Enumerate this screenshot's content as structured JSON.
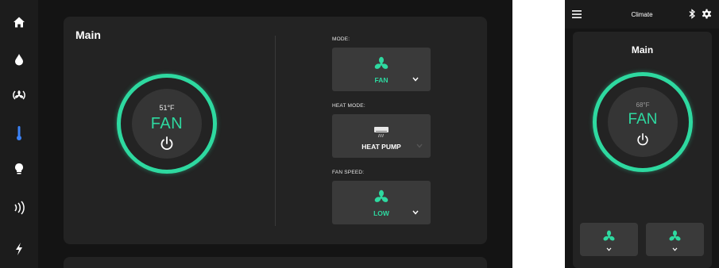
{
  "colors": {
    "accent": "#2ed9a0",
    "background": "#141414",
    "card": "#232323",
    "control": "#3a3a3a"
  },
  "sidebar": {
    "items": [
      {
        "icon": "home-icon"
      },
      {
        "icon": "water-drop-icon"
      },
      {
        "icon": "fan-mode-icon"
      },
      {
        "icon": "thermometer-icon",
        "active": true
      },
      {
        "icon": "lightbulb-icon"
      },
      {
        "icon": "audio-waves-icon"
      },
      {
        "icon": "lightning-icon"
      }
    ]
  },
  "main": {
    "title": "Main",
    "dial": {
      "temperature": "51°F",
      "mode": "FAN"
    },
    "controls": [
      {
        "label": "MODE:",
        "value": "FAN",
        "icon": "fan-icon"
      },
      {
        "label": "HEAT MODE:",
        "value": "HEAT PUMP",
        "icon": "heat-pump-icon"
      },
      {
        "label": "FAN SPEED:",
        "value": "LOW",
        "icon": "fan-icon"
      }
    ]
  },
  "phone": {
    "header_title": "Climate",
    "card_title": "Main",
    "dial": {
      "temperature": "68°F",
      "mode": "FAN"
    },
    "buttons": [
      {
        "icon": "fan-icon"
      },
      {
        "icon": "fan-icon"
      }
    ]
  }
}
